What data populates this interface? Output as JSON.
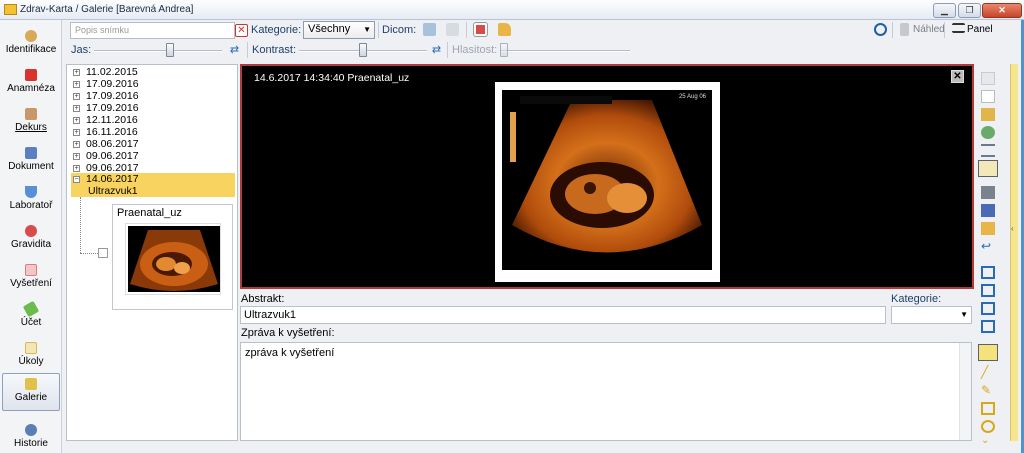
{
  "window": {
    "title": "Zdrav-Karta / Galerie [Barevná Andrea]"
  },
  "nav": [
    {
      "label": "Identifikace",
      "icon": "person-icon",
      "color": "#d9a95a"
    },
    {
      "label": "Anamnéza",
      "icon": "cross-icon",
      "color": "#d9342b"
    },
    {
      "label": "Dekurs",
      "icon": "briefcase-icon",
      "color": "#c9986a"
    },
    {
      "label": "Dokument",
      "icon": "document-icon",
      "color": "#5b7fbf"
    },
    {
      "label": "Laboratoř",
      "icon": "flask-icon",
      "color": "#5a8fd6"
    },
    {
      "label": "Gravidita",
      "icon": "pregnant-icon",
      "color": "#d94b4b"
    },
    {
      "label": "Vyšetření",
      "icon": "calendar-icon",
      "color": "#e07b7b"
    },
    {
      "label": "Účet",
      "icon": "money-icon",
      "color": "#6cbc4b"
    },
    {
      "label": "Úkoly",
      "icon": "clipboard-icon",
      "color": "#d8b85a"
    },
    {
      "label": "Galerie",
      "icon": "gallery-icon",
      "color": "#e0c24a"
    },
    {
      "label": "Historie",
      "icon": "globe-icon",
      "color": "#5a7fb5"
    }
  ],
  "toolbar": {
    "search_placeholder": "Popis snímku",
    "kategorie_label": "Kategorie:",
    "kategorie_value": "Všechny",
    "dicom_label": "Dicom:",
    "nahled_label": "Náhled",
    "panel_label": "Panel",
    "jas_label": "Jas:",
    "kontrast_label": "Kontrast:",
    "hlasitost_label": "Hlasitost:",
    "jas_level": 0.6,
    "kontrast_level": 0.5,
    "hlasitost_level": 0.0
  },
  "tree": {
    "dates": [
      "11.02.2015",
      "17.09.2016",
      "17.09.2016",
      "17.09.2016",
      "12.11.2016",
      "16.11.2016",
      "08.06.2017",
      "09.06.2017",
      "09.06.2017"
    ],
    "selected_date": "14.06.2017",
    "selected_name": "Ultrazvuk1",
    "thumb_label": "Praenatal_uz"
  },
  "viewer": {
    "title": "14.6.2017 14:34:40 Praenatal_uz",
    "close_glyph": "✕",
    "photo_date": "25 Aug 06"
  },
  "detail": {
    "abstrakt_label": "Abstrakt:",
    "abstrakt_value": "Ultrazvuk1",
    "kategorie_label": "Kategorie:",
    "zprava_label": "Zpráva k vyšetření:",
    "zprava_value": "zpráva k vyšetření"
  },
  "colors": {
    "accent": "#4c95d0",
    "selection": "#f8d360",
    "viewer_border": "#b23a3a"
  }
}
